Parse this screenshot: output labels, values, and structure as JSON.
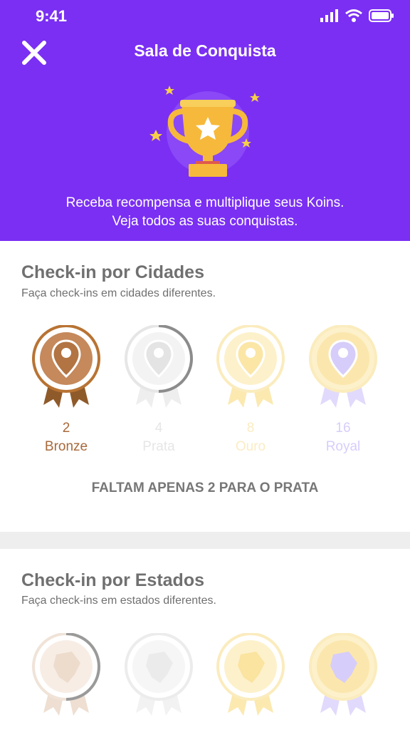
{
  "status_bar": {
    "time": "9:41"
  },
  "header": {
    "title": "Sala de Conquista",
    "subtitle_line1": "Receba recompensa e multiplique seus Koins.",
    "subtitle_line2": "Veja todos as suas conquistas."
  },
  "cities": {
    "title": "Check-in por Cidades",
    "description": "Faça check-ins em cidades diferentes.",
    "medals": [
      {
        "count": "2",
        "label": "Bronze",
        "color": "#b87333"
      },
      {
        "count": "4",
        "label": "Prata",
        "color": "#9e9e9e"
      },
      {
        "count": "8",
        "label": "Ouro",
        "color": "#f5c542"
      },
      {
        "count": "16",
        "label": "Royal",
        "color": "#8b6cf0"
      }
    ],
    "remaining": "FALTAM APENAS 2 PARA O PRATA"
  },
  "states": {
    "title": "Check-in por Estados",
    "description": "Faça check-ins em estados diferentes."
  },
  "colors": {
    "header_bg": "#7a2ff3",
    "text_gray": "#707070"
  }
}
